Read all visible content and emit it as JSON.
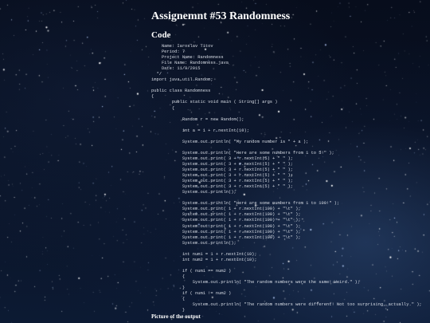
{
  "page": {
    "title": "Assignemnt #53 Randomness",
    "code_heading": "Code",
    "output_heading": "Picture of the output"
  },
  "code_lines": [
    "    Name: Iaroslav Titov",
    "    Period: 7",
    "    Project Name: Randomness",
    "    File Name: Randomness.java",
    "    Date: 11/9/2015",
    "  */",
    "import java.util.Random;",
    "",
    "public class Randomness",
    "{",
    "        public static void main ( String[] args )",
    "        {",
    "",
    "            Random r = new Random();",
    "",
    "            int a = 1 + r.nextInt(10);",
    "",
    "            System.out.println( \"My random number is \" + a );",
    "",
    "            System.out.println( \"Here are some numbers from 1 to 5!\" );",
    "            System.out.print( 3 + r.nextInt(5) + \" \" );",
    "            System.out.print( 3 + r.nextInt(5) + \" \" );",
    "            System.out.print( 3 + r.nextInt(5) + \" \" );",
    "            System.out.print( 3 + r.nextInt(5) + \" \" );",
    "            System.out.print( 3 + r.nextInt(5) + \" \" );",
    "            System.out.print( 3 + r.nextInt(5) + \" \" );",
    "            System.out.println();",
    "",
    "            System.out.println( \"Here are some numbers from 1 to 100!\" );",
    "            System.out.print( 1 + r.nextInt(100) + \"\\t\" );",
    "            System.out.print( 1 + r.nextInt(100) + \"\\t\" );",
    "            System.out.print( 1 + r.nextInt(100) + \"\\t\" );",
    "            System.out.print( 1 + r.nextInt(100) + \"\\t\" );",
    "            System.out.print( 1 + r.nextInt(100) + \"\\t\" );",
    "            System.out.print( 1 + r.nextInt(100) + \"\\t\" );",
    "            System.out.println();",
    "",
    "            int num1 = 1 + r.nextInt(10);",
    "            int num2 = 1 + r.nextInt(10);",
    "",
    "            if ( num1 == num2 )",
    "            {",
    "                System.out.println( \"The random numbers were the same! Weird.\" );",
    "            }",
    "            if ( num1 != num2 )",
    "            {",
    "                System.out.println( \"The random numbers were different! Not too surprising, actually.\" );",
    "            }"
  ]
}
